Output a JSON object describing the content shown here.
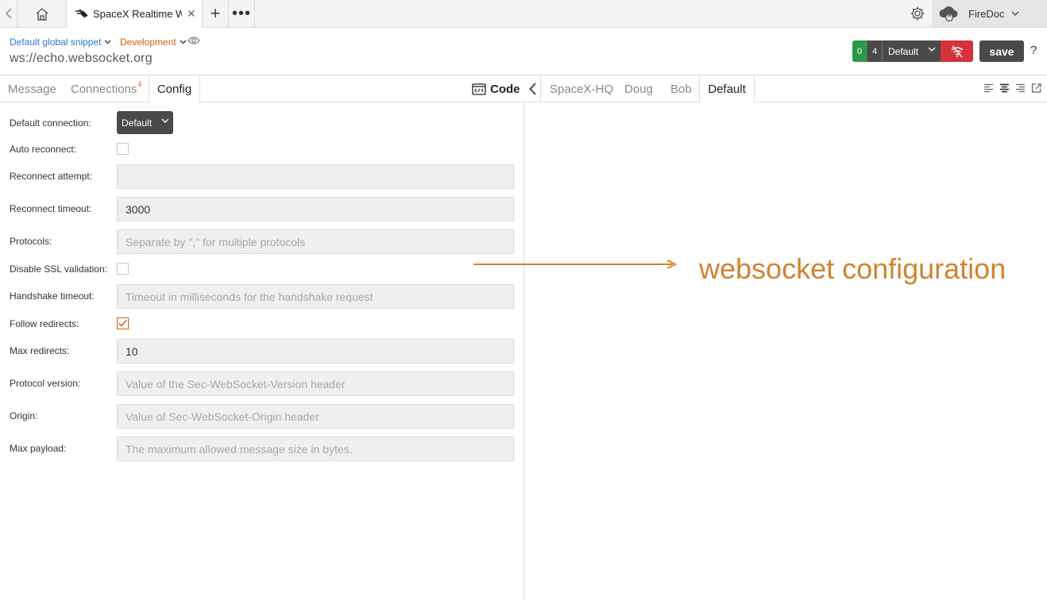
{
  "topbar": {
    "tab_title": "SpaceX Realtime WS",
    "user_name": "FireDoc",
    "icons": [
      "back-arrow-icon",
      "home-icon",
      "websocket-icon",
      "close-icon",
      "plus-icon",
      "more-icon",
      "gear-icon",
      "cloud-sync-icon",
      "chevron-down-icon"
    ]
  },
  "header": {
    "snippet": "Default global snippet",
    "environment": "Development",
    "url": "ws://echo.websocket.org",
    "count_connected": "0",
    "count_total": "4",
    "env_select": "Default",
    "save_label": "save",
    "help_label": "?"
  },
  "left_tabs": {
    "message": "Message",
    "connections": "Connections",
    "connections_badge": "4",
    "config": "Config",
    "code": "Code"
  },
  "right_tabs": [
    "SpaceX-HQ",
    "Doug",
    "Bob",
    "Default"
  ],
  "config": {
    "default_connection": {
      "label": "Default connection:",
      "value": "Default"
    },
    "auto_reconnect": {
      "label": "Auto reconnect:",
      "checked": false
    },
    "reconnect_attempt": {
      "label": "Reconnect attempt:",
      "value": ""
    },
    "reconnect_timeout": {
      "label": "Reconnect timeout:",
      "value": "3000"
    },
    "protocols": {
      "label": "Protocols:",
      "placeholder": "Separate by \",\" for multiple protocols"
    },
    "disable_ssl": {
      "label": "Disable SSL validation:",
      "checked": false
    },
    "handshake_timeout": {
      "label": "Handshake timeout:",
      "placeholder": "Timeout in milliseconds for the handshake request"
    },
    "follow_redirects": {
      "label": "Follow redirects:",
      "checked": true
    },
    "max_redirects": {
      "label": "Max redirects:",
      "value": "10"
    },
    "protocol_version": {
      "label": "Protocol version:",
      "placeholder": "Value of the Sec-WebSocket-Version header"
    },
    "origin": {
      "label": "Origin:",
      "placeholder": "Value of Sec-WebSocket-Origin header"
    },
    "max_payload": {
      "label": "Max payload:",
      "placeholder": "The maximum allowed message size in bytes."
    }
  },
  "annotation": "websocket configuration",
  "colors": {
    "accent_orange": "#d35f1a",
    "link_blue": "#2a78c8",
    "green": "#2b9a48",
    "red": "#d5323c",
    "annotation": "#d0832e"
  }
}
